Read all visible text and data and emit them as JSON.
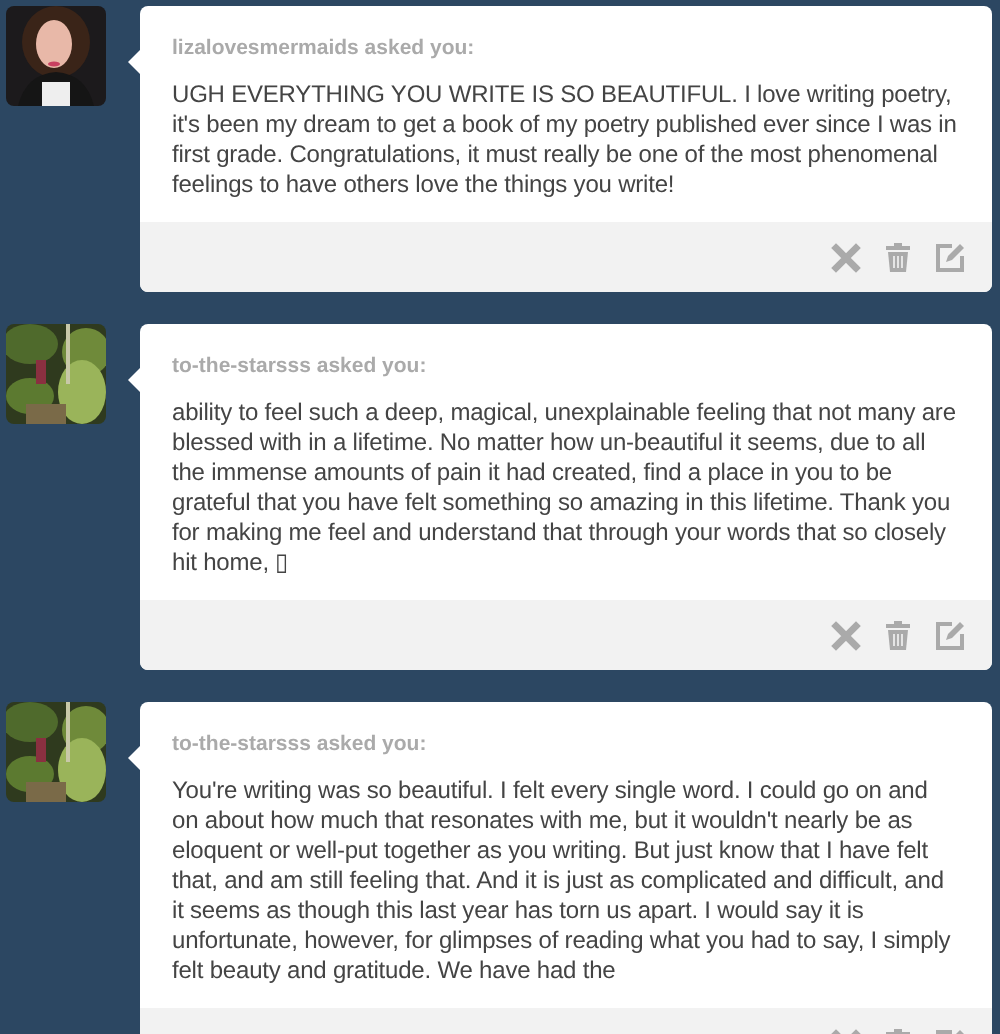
{
  "posts": [
    {
      "asker": "lizalovesmermaids asked you:",
      "question": "UGH EVERYTHING YOU WRITE IS SO BEAUTIFUL. I love writing poetry, it's been my dream to get a book of my poetry published ever since I was in first grade. Congratulations, it must really be one of the most phenomenal feelings to have others love the things you write!"
    },
    {
      "asker": "to-the-starsss asked you:",
      "question": "ability to feel such a deep, magical, unexplainable feeling that not many are blessed with in a lifetime. No matter how un-beautiful it seems, due to all the immense amounts of pain it had created, find a place in you to be grateful that you have felt something so amazing in this lifetime. Thank you for making me feel and understand that through your words that so closely hit home, ▯"
    },
    {
      "asker": "to-the-starsss asked you:",
      "question": "You're writing was so beautiful. I felt every single word. I could go on and on about how much that resonates with me, but it wouldn't nearly be as eloquent or well-put together as you writing. But just know that I have felt that, and am still feeling that. And it is just as complicated and difficult, and it seems as though this last year has torn us apart. I would say it is unfortunate, however, for glimpses of reading what you had to say, I simply felt beauty and gratitude. We have had the"
    }
  ]
}
